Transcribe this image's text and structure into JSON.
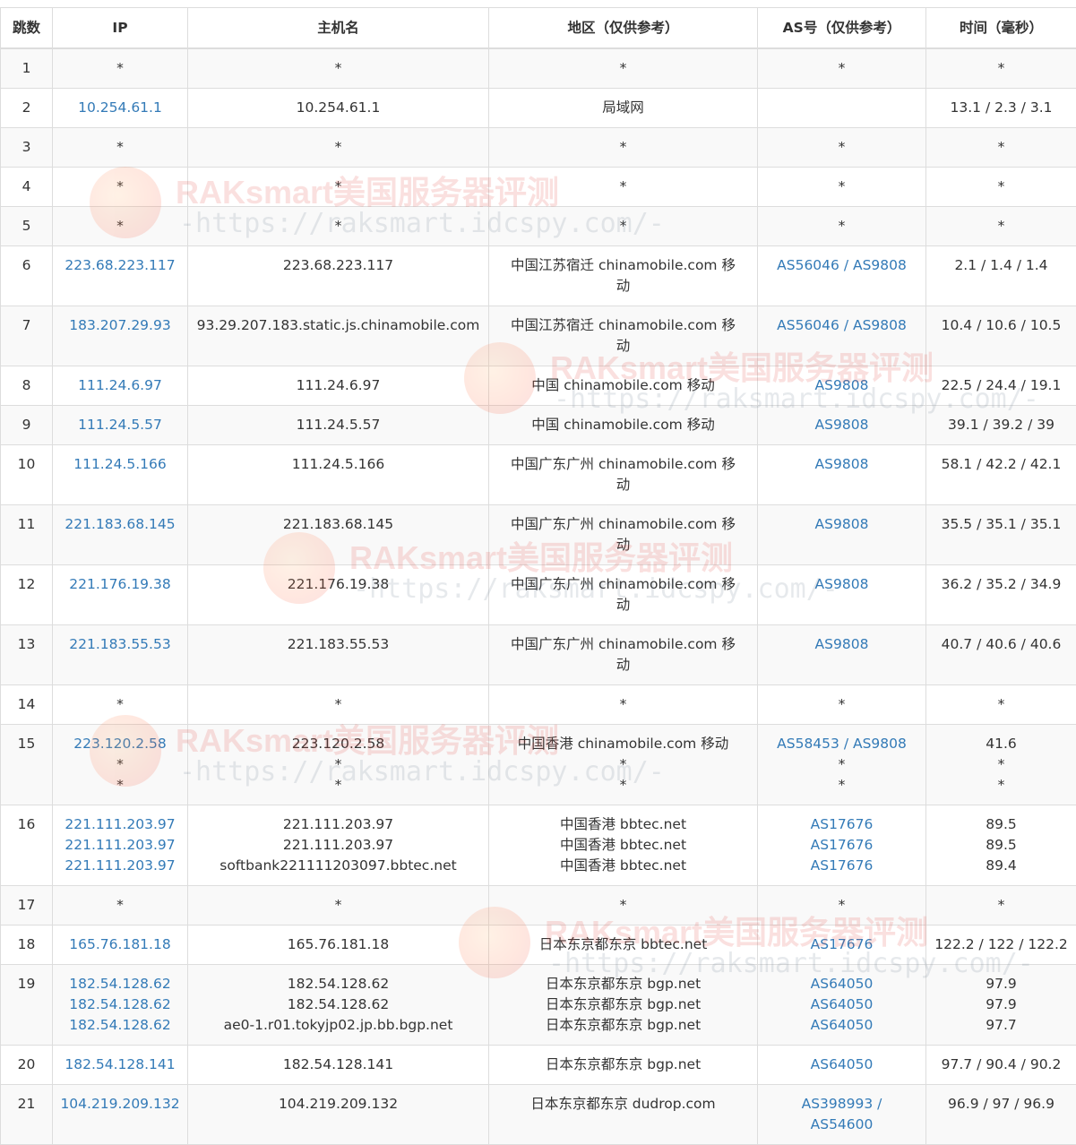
{
  "headers": [
    "跳数",
    "IP",
    "主机名",
    "地区（仅供参考）",
    "AS号（仅供参考）",
    "时间（毫秒）"
  ],
  "watermark": {
    "line1": "RAKsmart美国服务器评测",
    "line2": "-https://raksmart.idcspy.com/-"
  },
  "rows": [
    {
      "hop": "1",
      "ip": [
        "*"
      ],
      "host": [
        "*"
      ],
      "region": [
        "*"
      ],
      "as": [
        "*"
      ],
      "time": [
        "*"
      ]
    },
    {
      "hop": "2",
      "ip": [
        "10.254.61.1"
      ],
      "host": [
        "10.254.61.1"
      ],
      "region": [
        "局域网"
      ],
      "as": [
        ""
      ],
      "time": [
        "13.1 / 2.3 / 3.1"
      ]
    },
    {
      "hop": "3",
      "ip": [
        "*"
      ],
      "host": [
        "*"
      ],
      "region": [
        "*"
      ],
      "as": [
        "*"
      ],
      "time": [
        "*"
      ]
    },
    {
      "hop": "4",
      "ip": [
        "*"
      ],
      "host": [
        "*"
      ],
      "region": [
        "*"
      ],
      "as": [
        "*"
      ],
      "time": [
        "*"
      ]
    },
    {
      "hop": "5",
      "ip": [
        "*"
      ],
      "host": [
        "*"
      ],
      "region": [
        "*"
      ],
      "as": [
        "*"
      ],
      "time": [
        "*"
      ]
    },
    {
      "hop": "6",
      "ip": [
        "223.68.223.117"
      ],
      "host": [
        "223.68.223.117"
      ],
      "region": [
        "中国江苏宿迁 chinamobile.com 移",
        "动"
      ],
      "as": [
        "AS56046 / AS9808"
      ],
      "time": [
        "2.1 / 1.4 / 1.4"
      ]
    },
    {
      "hop": "7",
      "ip": [
        "183.207.29.93"
      ],
      "host": [
        "93.29.207.183.static.js.chinamobile.com"
      ],
      "region": [
        "中国江苏宿迁 chinamobile.com 移",
        "动"
      ],
      "as": [
        "AS56046 / AS9808"
      ],
      "time": [
        "10.4 / 10.6 / 10.5"
      ]
    },
    {
      "hop": "8",
      "ip": [
        "111.24.6.97"
      ],
      "host": [
        "111.24.6.97"
      ],
      "region": [
        "中国 chinamobile.com 移动"
      ],
      "as": [
        "AS9808"
      ],
      "time": [
        "22.5 / 24.4 / 19.1"
      ]
    },
    {
      "hop": "9",
      "ip": [
        "111.24.5.57"
      ],
      "host": [
        "111.24.5.57"
      ],
      "region": [
        "中国 chinamobile.com 移动"
      ],
      "as": [
        "AS9808"
      ],
      "time": [
        "39.1 / 39.2 / 39"
      ]
    },
    {
      "hop": "10",
      "ip": [
        "111.24.5.166"
      ],
      "host": [
        "111.24.5.166"
      ],
      "region": [
        "中国广东广州 chinamobile.com 移",
        "动"
      ],
      "as": [
        "AS9808"
      ],
      "time": [
        "58.1 / 42.2 / 42.1"
      ]
    },
    {
      "hop": "11",
      "ip": [
        "221.183.68.145"
      ],
      "host": [
        "221.183.68.145"
      ],
      "region": [
        "中国广东广州 chinamobile.com 移",
        "动"
      ],
      "as": [
        "AS9808"
      ],
      "time": [
        "35.5 / 35.1 / 35.1"
      ]
    },
    {
      "hop": "12",
      "ip": [
        "221.176.19.38"
      ],
      "host": [
        "221.176.19.38"
      ],
      "region": [
        "中国广东广州 chinamobile.com 移",
        "动"
      ],
      "as": [
        "AS9808"
      ],
      "time": [
        "36.2 / 35.2 / 34.9"
      ]
    },
    {
      "hop": "13",
      "ip": [
        "221.183.55.53"
      ],
      "host": [
        "221.183.55.53"
      ],
      "region": [
        "中国广东广州 chinamobile.com 移",
        "动"
      ],
      "as": [
        "AS9808"
      ],
      "time": [
        "40.7 / 40.6 / 40.6"
      ]
    },
    {
      "hop": "14",
      "ip": [
        "*"
      ],
      "host": [
        "*"
      ],
      "region": [
        "*"
      ],
      "as": [
        "*"
      ],
      "time": [
        "*"
      ]
    },
    {
      "hop": "15",
      "ip": [
        "223.120.2.58",
        "*",
        "*"
      ],
      "host": [
        "223.120.2.58",
        "*",
        "*"
      ],
      "region": [
        "中国香港 chinamobile.com 移动",
        "*",
        "*"
      ],
      "as": [
        "AS58453 / AS9808",
        "*",
        "*"
      ],
      "time": [
        "41.6",
        "*",
        "*"
      ]
    },
    {
      "hop": "16",
      "ip": [
        "221.111.203.97",
        "221.111.203.97",
        "221.111.203.97"
      ],
      "host": [
        "221.111.203.97",
        "221.111.203.97",
        "softbank221111203097.bbtec.net"
      ],
      "region": [
        "中国香港 bbtec.net",
        "中国香港 bbtec.net",
        "中国香港 bbtec.net"
      ],
      "as": [
        "AS17676",
        "AS17676",
        "AS17676"
      ],
      "time": [
        "89.5",
        "89.5",
        "89.4"
      ]
    },
    {
      "hop": "17",
      "ip": [
        "*"
      ],
      "host": [
        "*"
      ],
      "region": [
        "*"
      ],
      "as": [
        "*"
      ],
      "time": [
        "*"
      ]
    },
    {
      "hop": "18",
      "ip": [
        "165.76.181.18"
      ],
      "host": [
        "165.76.181.18"
      ],
      "region": [
        "日本东京都东京 bbtec.net"
      ],
      "as": [
        "AS17676"
      ],
      "time": [
        "122.2 / 122 / 122.2"
      ]
    },
    {
      "hop": "19",
      "ip": [
        "182.54.128.62",
        "182.54.128.62",
        "182.54.128.62"
      ],
      "host": [
        "182.54.128.62",
        "182.54.128.62",
        "ae0-1.r01.tokyjp02.jp.bb.bgp.net"
      ],
      "region": [
        "日本东京都东京 bgp.net",
        "日本东京都东京 bgp.net",
        "日本东京都东京 bgp.net"
      ],
      "as": [
        "AS64050",
        "AS64050",
        "AS64050"
      ],
      "time": [
        "97.9",
        "97.9",
        "97.7"
      ]
    },
    {
      "hop": "20",
      "ip": [
        "182.54.128.141"
      ],
      "host": [
        "182.54.128.141"
      ],
      "region": [
        "日本东京都东京 bgp.net"
      ],
      "as": [
        "AS64050"
      ],
      "time": [
        "97.7 / 90.4 / 90.2"
      ]
    },
    {
      "hop": "21",
      "ip": [
        "104.219.209.132"
      ],
      "host": [
        "104.219.209.132"
      ],
      "region": [
        "日本东京都东京 dudrop.com"
      ],
      "as": [
        "AS398993 /",
        "AS54600"
      ],
      "time": [
        "96.9 / 97 / 96.9"
      ]
    }
  ]
}
